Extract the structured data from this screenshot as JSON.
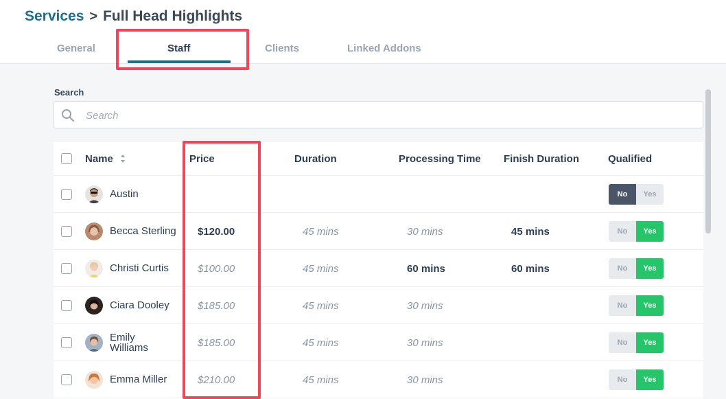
{
  "breadcrumb": {
    "parent": "Services",
    "separator": ">",
    "current": "Full Head Highlights"
  },
  "tabs": [
    {
      "label": "General"
    },
    {
      "label": "Staff",
      "active": true
    },
    {
      "label": "Clients"
    },
    {
      "label": "Linked Addons"
    }
  ],
  "search": {
    "label": "Search",
    "placeholder": "Search",
    "value": ""
  },
  "table": {
    "headers": {
      "name": "Name",
      "price": "Price",
      "duration": "Duration",
      "processing": "Processing Time",
      "finish": "Finish Duration",
      "qualified": "Qualified"
    },
    "rows": [
      {
        "first": "Austin",
        "last": "",
        "price": "",
        "duration": "",
        "processing": "",
        "finish": "",
        "no": "No",
        "yes": "Yes",
        "qualified": "No"
      },
      {
        "first": "Becca Sterling",
        "last": "",
        "price": "$120.00",
        "duration": "45 mins",
        "processing": "30 mins",
        "finish": "45 mins",
        "no": "No",
        "yes": "Yes",
        "qualified": "Yes"
      },
      {
        "first": "Christi Curtis",
        "last": "",
        "price": "$100.00",
        "duration": "45 mins",
        "processing": "60 mins",
        "finish": "60 mins",
        "no": "No",
        "yes": "Yes",
        "qualified": "Yes"
      },
      {
        "first": "Ciara Dooley",
        "last": "",
        "price": "$185.00",
        "duration": "45 mins",
        "processing": "30 mins",
        "finish": "",
        "no": "No",
        "yes": "Yes",
        "qualified": "Yes"
      },
      {
        "first": "Emily",
        "last": "Williams",
        "price": "$185.00",
        "duration": "45 mins",
        "processing": "30 mins",
        "finish": "",
        "no": "No",
        "yes": "Yes",
        "qualified": "Yes"
      },
      {
        "first": "Emma Miller",
        "last": "",
        "price": "$210.00",
        "duration": "45 mins",
        "processing": "30 mins",
        "finish": "",
        "no": "No",
        "yes": "Yes",
        "qualified": "Yes"
      }
    ]
  },
  "colors": {
    "brand": "#1b6f8c",
    "highlight": "#f2455b",
    "yes_on": "#26c56a",
    "no_on": "#4a5568"
  }
}
